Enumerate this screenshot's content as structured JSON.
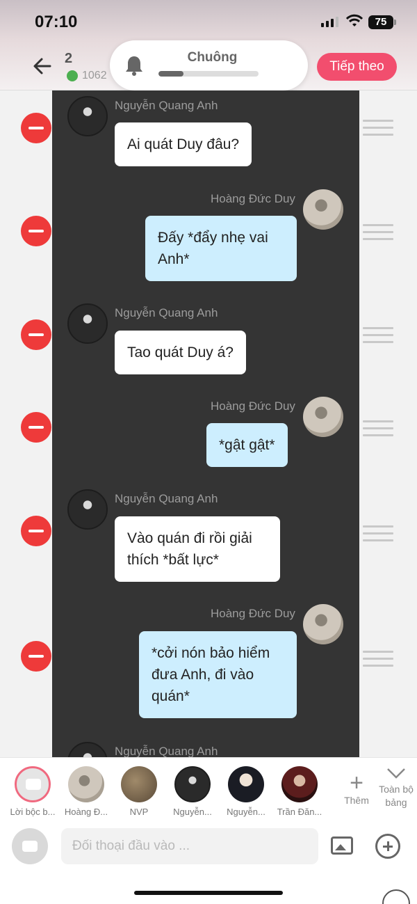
{
  "status": {
    "time": "07:10",
    "battery": "75"
  },
  "header": {
    "count": "2",
    "subcount": "1062",
    "bell": {
      "label": "Chuông",
      "progress": 0.25
    },
    "next_label": "Tiếp theo"
  },
  "messages": [
    {
      "sender": "Nguyễn Quang Anh",
      "side": "left",
      "text": "Ai quát Duy đâu?"
    },
    {
      "sender": "Hoàng Đức Duy",
      "side": "right",
      "text": "Đấy *đẩy nhẹ vai Anh*"
    },
    {
      "sender": "Nguyễn Quang Anh",
      "side": "left",
      "text": "Tao quát Duy á?"
    },
    {
      "sender": "Hoàng Đức Duy",
      "side": "right",
      "text": "*gật gật*"
    },
    {
      "sender": "Nguyễn Quang Anh",
      "side": "left",
      "text": "Vào quán đi rồi giải thích *bất lực*"
    },
    {
      "sender": "Hoàng Đức Duy",
      "side": "right",
      "text": "*cởi nón bảo hiểm đưa Anh, đi vào quán*"
    },
    {
      "sender": "Nguyễn Quang Anh",
      "side": "left",
      "text": ""
    }
  ],
  "characters": [
    {
      "label": "Lời bộc b..."
    },
    {
      "label": "Hoàng Đ..."
    },
    {
      "label": "NVP"
    },
    {
      "label": "Nguyễn..."
    },
    {
      "label": "Nguyễn..."
    },
    {
      "label": "Trần Đăn..."
    }
  ],
  "more_label": "Thêm",
  "all_label": "Toàn bộ bảng",
  "input": {
    "placeholder": "Đối thoại đầu vào ..."
  },
  "icons": [
    "back-arrow-icon",
    "bell-icon",
    "delete-icon",
    "drag-handle-icon",
    "narration-icon",
    "image-icon",
    "add-icon",
    "chevron-down-icon",
    "plus-icon"
  ]
}
